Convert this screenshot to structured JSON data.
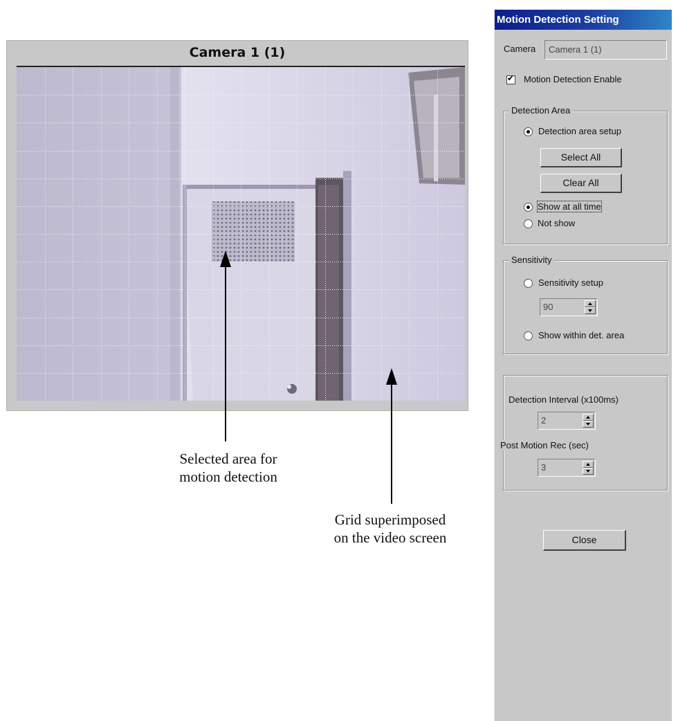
{
  "camera_view": {
    "title": "Camera 1 (1)"
  },
  "annotations": {
    "selected_area": [
      "Selected area for",
      "motion detection"
    ],
    "grid": [
      "Grid superimposed",
      "on the video screen"
    ]
  },
  "dialog": {
    "title": "Motion Detection Setting",
    "camera_label": "Camera",
    "camera_value": "Camera 1 (1)",
    "motion_enable_label": "Motion Detection Enable",
    "motion_enable_checked": true,
    "detection_area": {
      "group_label": "Detection Area",
      "setup_label": "Detection area setup",
      "select_all_label": "Select All",
      "clear_all_label": "Clear All",
      "show_all_label": "Show at all time",
      "not_show_label": "Not show"
    },
    "sensitivity": {
      "group_label": "Sensitivity",
      "setup_label": "Sensitivity setup",
      "value": "90",
      "show_within_label": "Show within det. area"
    },
    "detection_interval_label": "Detection Interval (x100ms)",
    "detection_interval_value": "2",
    "post_motion_label": "Post Motion Rec (sec)",
    "post_motion_value": "3",
    "close_label": "Close"
  },
  "colors": {
    "title_bar_start": "#0c1f8a",
    "title_bar_end": "#2e86c8",
    "dialog_bg": "#c8c8c8",
    "wall": "#cfcbe0"
  }
}
